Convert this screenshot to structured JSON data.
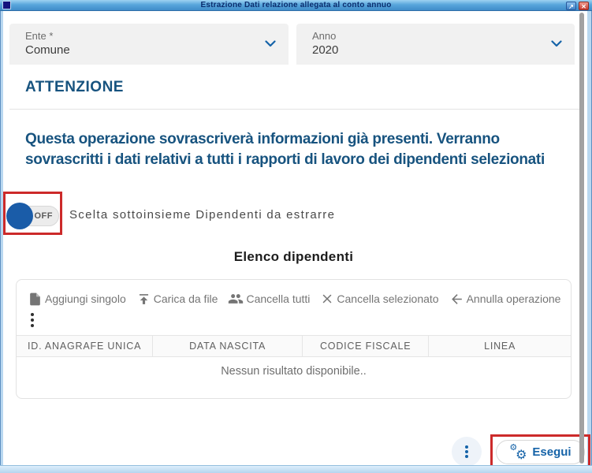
{
  "window": {
    "title": "Estrazione Dati relazione allegata al conto annuo",
    "restore_glyph": "↗",
    "close_glyph": "✕"
  },
  "filters": {
    "ente_label": "Ente *",
    "ente_value": "Comune",
    "anno_label": "Anno",
    "anno_value": "2020"
  },
  "warning": {
    "heading": "ATTENZIONE",
    "message": "Questa operazione sovrascriverà informazioni già presenti. Verranno sovrascritti i dati relativi a tutti i rapporti di lavoro dei dipendenti selezionati"
  },
  "subset_toggle": {
    "state": "OFF",
    "label": "Scelta sottoinsieme Dipendenti da estrarre"
  },
  "employee_list": {
    "title": "Elenco dipendenti",
    "toolbar": [
      {
        "icon": "add-file-icon",
        "label": "Aggiungi singolo"
      },
      {
        "icon": "upload-icon",
        "label": "Carica da file"
      },
      {
        "icon": "people-icon",
        "label": "Cancella tutti"
      },
      {
        "icon": "close-icon",
        "label": "Cancella selezionato"
      },
      {
        "icon": "undo-icon",
        "label": "Annulla operazione"
      }
    ],
    "columns": [
      "ID. ANAGRAFE UNICA",
      "DATA NASCITA",
      "CODICE FISCALE",
      "LINEA"
    ],
    "empty_message": "Nessun risultato disponibile.."
  },
  "footer": {
    "execute_label": "Esegui",
    "gear_glyph": "⚙"
  },
  "colors": {
    "accent_blue": "#1563a8",
    "heading_blue": "#17537f",
    "toggle_thumb_blue": "#1a5ca8",
    "annotation_red": "#cc2a2a",
    "titlebar_top": "#9ed2f2",
    "titlebar_bottom": "#3f8cc9",
    "toolbar_gray": "#757575"
  }
}
